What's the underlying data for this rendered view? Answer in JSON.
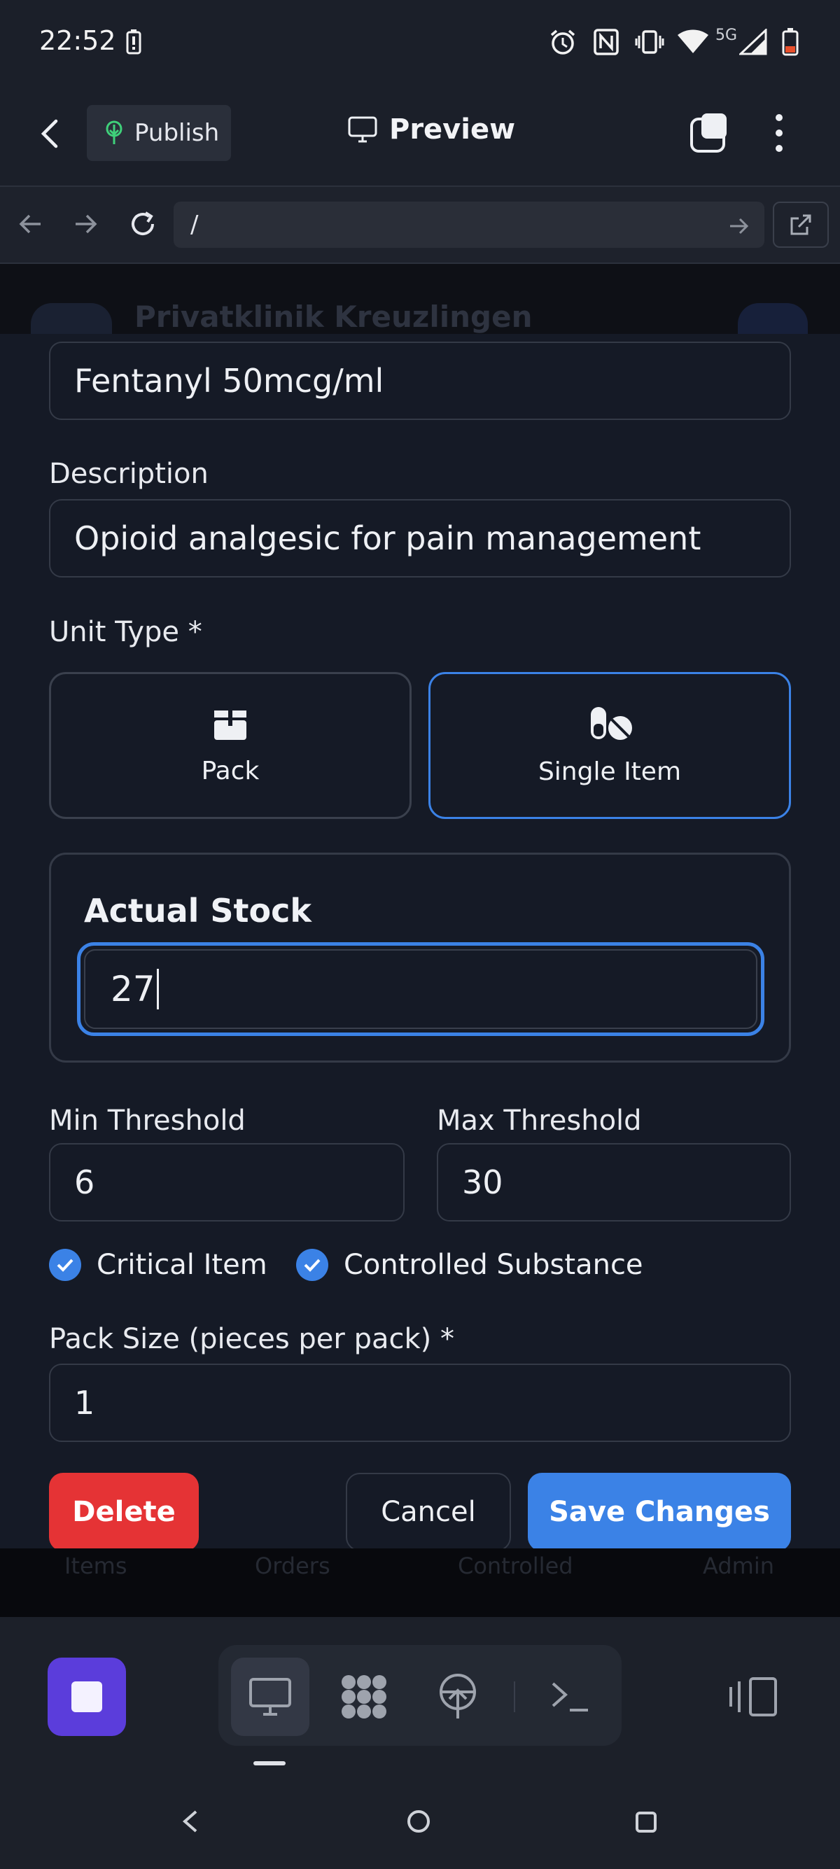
{
  "status_bar": {
    "time": "22:52",
    "network": "5G"
  },
  "app_header": {
    "publish_label": "Publish",
    "preview_label": "Preview"
  },
  "browser": {
    "url": "/"
  },
  "background_page": {
    "clinic_name": "Privatklinik Kreuzlingen",
    "nav_tabs": [
      "Items",
      "Orders",
      "Controlled",
      "Admin"
    ]
  },
  "form": {
    "name_value": "Fentanyl 50mcg/ml",
    "description_label": "Description",
    "description_value": "Opioid analgesic for pain management",
    "unit_type_label": "Unit Type *",
    "unit_options": [
      {
        "label": "Pack",
        "icon": "box-icon",
        "selected": false
      },
      {
        "label": "Single Item",
        "icon": "pills-icon",
        "selected": true
      }
    ],
    "actual_stock_label": "Actual Stock",
    "actual_stock_value": "27",
    "min_threshold_label": "Min Threshold",
    "min_threshold_value": "6",
    "max_threshold_label": "Max Threshold",
    "max_threshold_value": "30",
    "critical_item_label": "Critical Item",
    "critical_item_checked": true,
    "controlled_substance_label": "Controlled Substance",
    "controlled_substance_checked": true,
    "pack_size_label": "Pack Size (pieces per pack) *",
    "pack_size_value": "1"
  },
  "actions": {
    "delete_label": "Delete",
    "cancel_label": "Cancel",
    "save_label": "Save Changes"
  },
  "colors": {
    "accent": "#3b82e6",
    "danger": "#e53335",
    "modal_bg": "#151a26",
    "stop_button": "#5b3ddb"
  }
}
